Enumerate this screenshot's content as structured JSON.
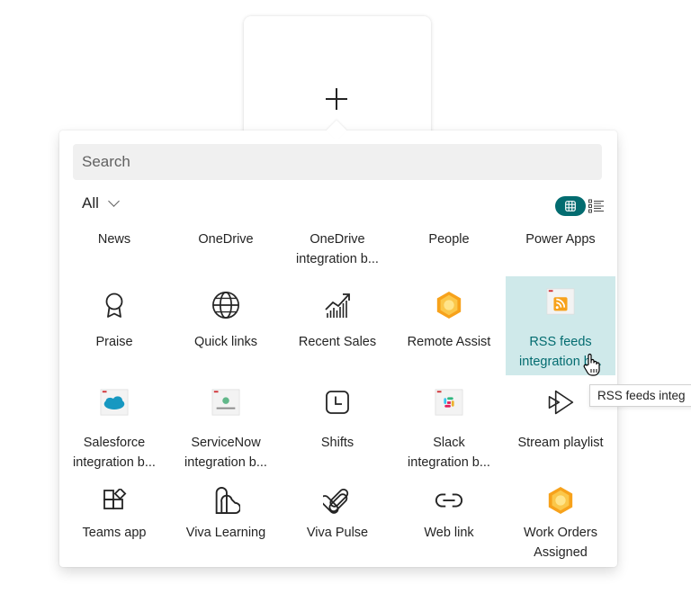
{
  "search": {
    "placeholder": "Search"
  },
  "filter": {
    "label": "All"
  },
  "tiles": [
    {
      "label": "News",
      "icon": "news-icon"
    },
    {
      "label": "OneDrive",
      "icon": "onedrive-icon"
    },
    {
      "label": "OneDrive\nintegration b...",
      "icon": "onedrive-integration-icon"
    },
    {
      "label": "People",
      "icon": "people-icon"
    },
    {
      "label": "Power Apps",
      "icon": "power-apps-icon"
    },
    {
      "label": "Praise",
      "icon": "ribbon-icon"
    },
    {
      "label": "Quick links",
      "icon": "globe-icon"
    },
    {
      "label": "Recent Sales",
      "icon": "chart-trend-icon"
    },
    {
      "label": "Remote Assist",
      "icon": "remote-assist-icon"
    },
    {
      "label": "RSS feeds\nintegration b...",
      "icon": "rss-icon"
    },
    {
      "label": "Salesforce\nintegration b...",
      "icon": "salesforce-icon"
    },
    {
      "label": "ServiceNow\nintegration b...",
      "icon": "servicenow-icon"
    },
    {
      "label": "Shifts",
      "icon": "clock-square-icon"
    },
    {
      "label": "Slack\nintegration b...",
      "icon": "slack-icon"
    },
    {
      "label": "Stream playlist",
      "icon": "stream-icon"
    },
    {
      "label": "Teams app",
      "icon": "apps-add-icon"
    },
    {
      "label": "Viva Learning",
      "icon": "viva-learning-icon"
    },
    {
      "label": "Viva Pulse",
      "icon": "viva-pulse-icon"
    },
    {
      "label": "Web link",
      "icon": "link-icon"
    },
    {
      "label": "Work Orders\nAssigned",
      "icon": "work-orders-icon"
    }
  ],
  "tooltip": {
    "text": "RSS feeds integ"
  },
  "colors": {
    "accent": "#036c70",
    "selected_bg": "#cfe9ea",
    "hex_orange": "#f7a21b"
  }
}
